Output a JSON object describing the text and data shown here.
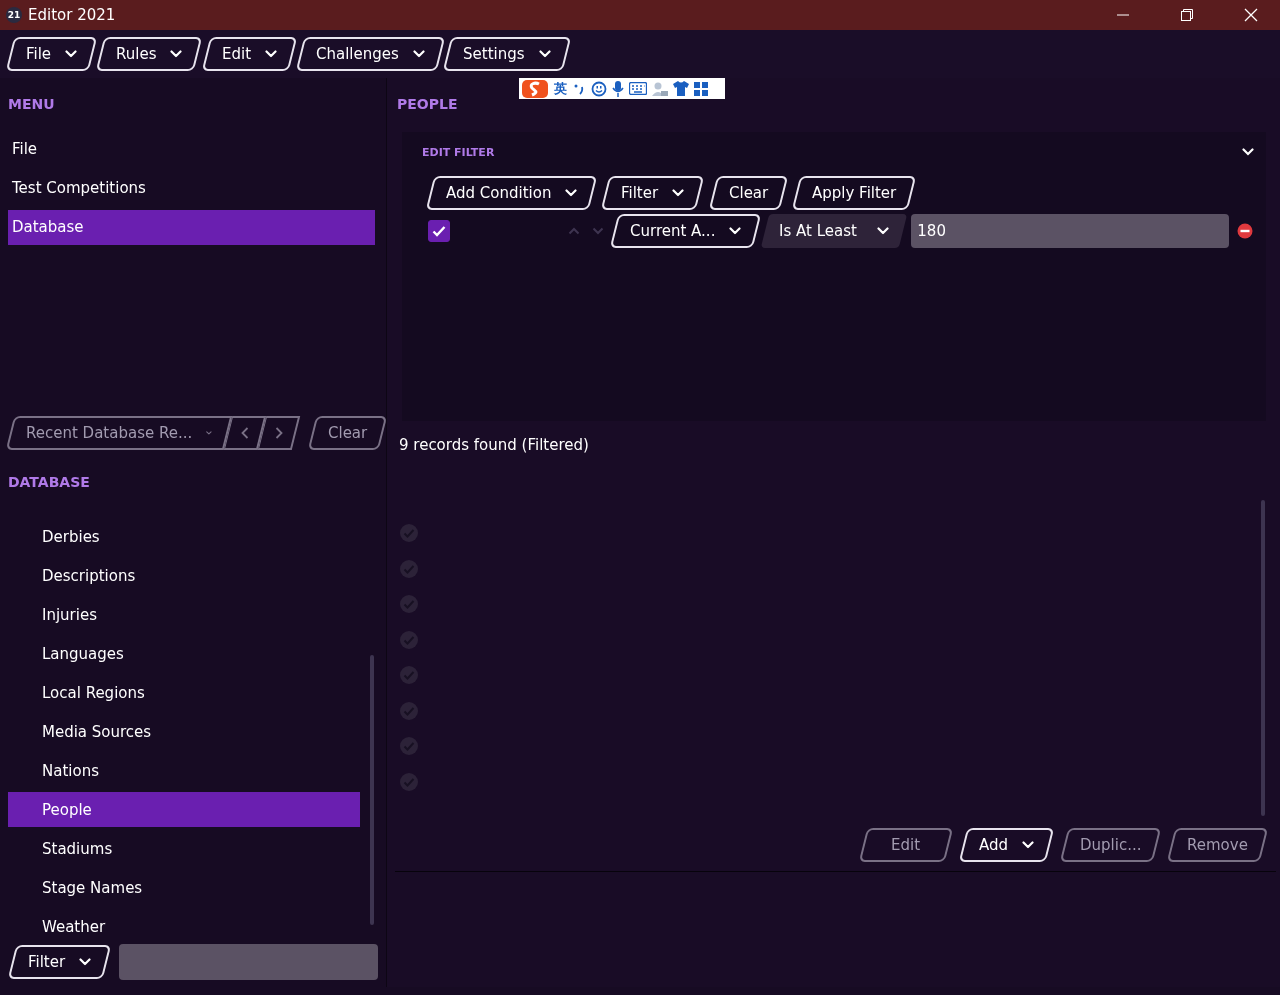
{
  "window": {
    "title": "Editor 2021",
    "app_badge": "21"
  },
  "menu_bar": [
    {
      "label": "File"
    },
    {
      "label": "Rules"
    },
    {
      "label": "Edit"
    },
    {
      "label": "Challenges"
    },
    {
      "label": "Settings"
    }
  ],
  "ime_toolbar": {
    "mode": "英"
  },
  "sidebar": {
    "title": "MENU",
    "items": [
      {
        "label": "File",
        "selected": false
      },
      {
        "label": "Test Competitions",
        "selected": false
      },
      {
        "label": "Database",
        "selected": true
      }
    ],
    "recent": {
      "label": "Recent Database Re...",
      "disabled": true
    },
    "clear": {
      "label": "Clear",
      "disabled": true
    },
    "database_title": "DATABASE",
    "database_items": [
      {
        "label": "Derbies",
        "selected": false
      },
      {
        "label": "Descriptions",
        "selected": false
      },
      {
        "label": "Injuries",
        "selected": false
      },
      {
        "label": "Languages",
        "selected": false
      },
      {
        "label": "Local Regions",
        "selected": false
      },
      {
        "label": "Media Sources",
        "selected": false
      },
      {
        "label": "Nations",
        "selected": false
      },
      {
        "label": "People",
        "selected": true
      },
      {
        "label": "Stadiums",
        "selected": false
      },
      {
        "label": "Stage Names",
        "selected": false
      },
      {
        "label": "Weather",
        "selected": false
      }
    ],
    "filter_button": "Filter"
  },
  "main": {
    "title": "PEOPLE",
    "edit_filter": {
      "title": "EDIT FILTER",
      "expanded": true,
      "buttons": [
        {
          "label": "Add Condition",
          "dropdown": true
        },
        {
          "label": "Filter",
          "dropdown": true
        },
        {
          "label": "Clear",
          "dropdown": false
        },
        {
          "label": "Apply Filter",
          "dropdown": false
        }
      ],
      "condition": {
        "checked": true,
        "field": "Current A...",
        "operator": "Is At Least",
        "value": "180"
      }
    },
    "records_found": "9 records found (Filtered)",
    "records": [
      {
        "checked": true
      },
      {
        "checked": true
      },
      {
        "checked": true
      },
      {
        "checked": true
      },
      {
        "checked": true
      },
      {
        "checked": true
      },
      {
        "checked": true
      },
      {
        "checked": true
      }
    ],
    "actions": [
      {
        "label": "Edit",
        "dropdown": false,
        "disabled": true
      },
      {
        "label": "Add",
        "dropdown": true,
        "disabled": false
      },
      {
        "label": "Duplic...",
        "dropdown": false,
        "disabled": true
      },
      {
        "label": "Remove",
        "dropdown": false,
        "disabled": true
      }
    ]
  }
}
